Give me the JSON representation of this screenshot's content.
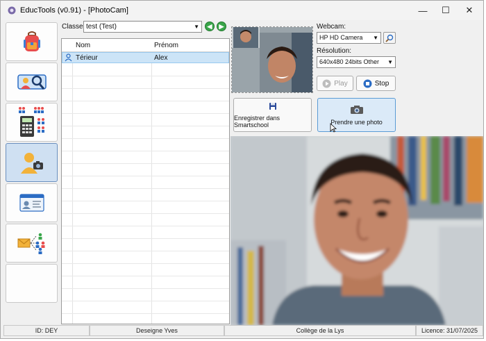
{
  "window": {
    "title": "EducTools (v0.91) - [PhotoCam]",
    "controls": [
      "—",
      "☐",
      "✕"
    ]
  },
  "sidebar": {
    "items": [
      {
        "icon": "backpack-icon",
        "active": false
      },
      {
        "icon": "student-search-icon",
        "active": false
      },
      {
        "icon": "calculator-groups-icon",
        "active": false
      },
      {
        "icon": "person-camera-icon",
        "active": true
      },
      {
        "icon": "id-card-icon",
        "active": false
      },
      {
        "icon": "mail-group-icon",
        "active": false
      },
      {
        "icon": "empty-slot",
        "active": false
      }
    ]
  },
  "classe": {
    "label": "Classe:",
    "value": "test (Test)"
  },
  "grid": {
    "columns": [
      "Nom",
      "Prénom"
    ],
    "rows": [
      {
        "nom": "Térieur",
        "prenom": "Alex",
        "selected": true
      }
    ]
  },
  "webcam": {
    "label": "Webcam:",
    "value": "HP HD Camera"
  },
  "resolution": {
    "label": "Résolution:",
    "value": "640x480 24bits Other"
  },
  "buttons": {
    "play": "Play",
    "stop": "Stop",
    "save": "Enregistrer dans Smartschool",
    "capture": "Prendre une photo"
  },
  "status": {
    "id": "ID: DEY",
    "user": "Deseigne Yves",
    "school": "Collège de la Lys",
    "licence": "Licence: 31/07/2025"
  },
  "colors": {
    "accent": "#5a9bd5",
    "selection": "#cce4f7",
    "active_sidebar": "#cfe0f2",
    "nav_green": "#3aa64a"
  }
}
